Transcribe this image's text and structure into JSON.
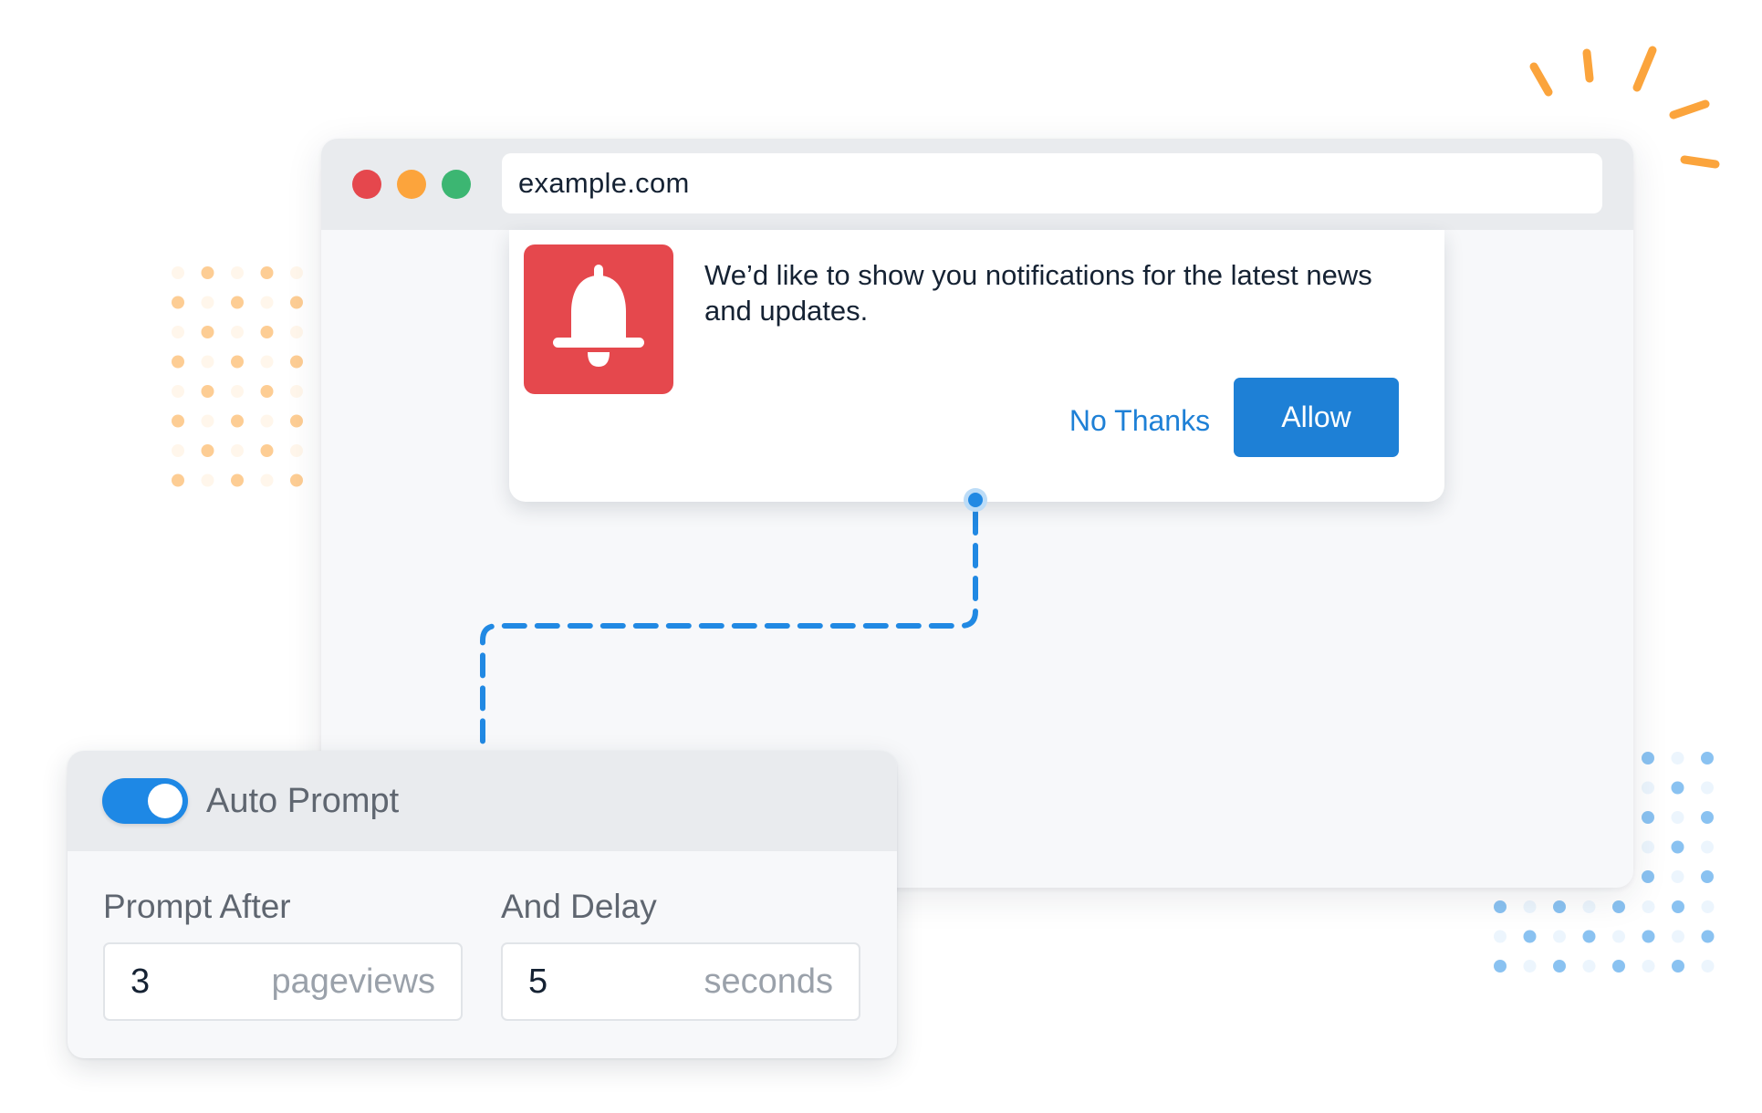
{
  "browser": {
    "url": "example.com",
    "window_controls": [
      "close",
      "minimize",
      "maximize"
    ]
  },
  "notification_popup": {
    "icon": "bell-icon",
    "message": "We’d like to show you notifications for the latest news and updates.",
    "decline_label": "No Thanks",
    "accept_label": "Allow"
  },
  "auto_prompt": {
    "title": "Auto Prompt",
    "enabled": true,
    "fields": [
      {
        "label": "Prompt After",
        "value": "3",
        "unit": "pageviews"
      },
      {
        "label": "And Delay",
        "value": "5",
        "unit": "seconds"
      }
    ]
  },
  "colors": {
    "accent_blue": "#1e80d6",
    "bell_red": "#e5484d",
    "traffic_red": "#e5474d",
    "traffic_orange": "#fca43c",
    "traffic_green": "#3cb672",
    "decor_orange": "#fba43c",
    "decor_blue": "#7dbbf0"
  }
}
